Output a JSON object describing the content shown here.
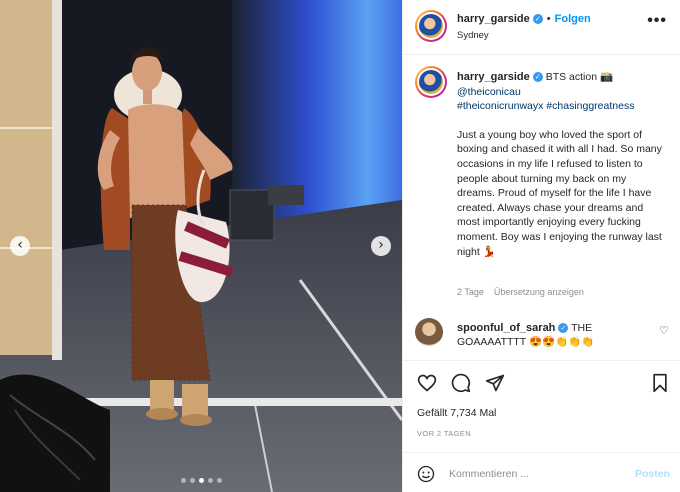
{
  "header": {
    "username": "harry_garside",
    "follow_label": "Folgen",
    "location": "Sydney",
    "more_label": "•••"
  },
  "caption": {
    "username": "harry_garside",
    "first_line": "BTS action 📸",
    "mention": "@theiconicau",
    "hashtags": "#theiconicrunwayx #chasinggreatness",
    "body": "Just a young boy who loved the sport of boxing and chased it with all I had. So many occasions in my life I refused to listen to people about turning my back on my dreams. Proud of myself for the life I have created. Always chase your dreams and most importantly enjoying every fucking moment. Boy was I enjoying the runway last night 💃",
    "age": "2 Tage",
    "translate_label": "Übersetzung anzeigen"
  },
  "comment": {
    "username": "spoonful_of_sarah",
    "text": "THE GOAAAATTTT 😍😍👏👏👏"
  },
  "actions": {
    "likes": "Gefällt 7,734 Mal",
    "timestamp": "VOR 2 TAGEN"
  },
  "comment_box": {
    "placeholder": "Kommentieren ...",
    "post_label": "Posten"
  },
  "carousel": {
    "prev_label": "‹",
    "next_label": "›",
    "slide_count": 5,
    "active_slide": 3
  },
  "colors": {
    "link": "#00376b",
    "accent": "#0095f6",
    "verified": "#3897f0",
    "muted": "#8e8e8e"
  }
}
